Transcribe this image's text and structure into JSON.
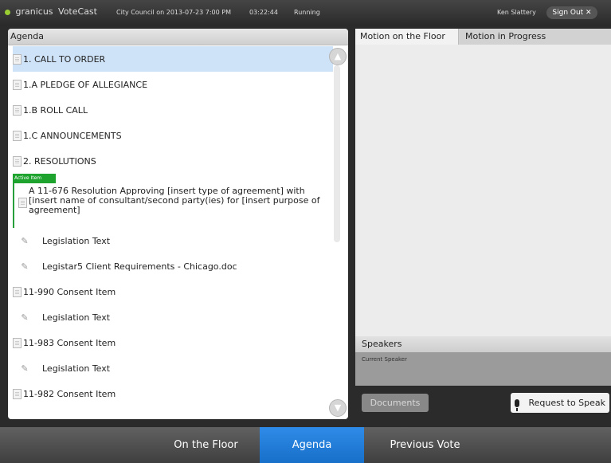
{
  "header": {
    "brand": "granicus",
    "product": "VoteCast",
    "meeting": "City Council on 2013-07-23 7:00 PM",
    "clock": "03:22:44",
    "status": "Running",
    "user": "Ken Slattery",
    "signout_label": "Sign Out ✕"
  },
  "agenda": {
    "title": "Agenda",
    "items": [
      {
        "label": "1.  CALL TO ORDER",
        "selected": true,
        "icon": "document-icon"
      },
      {
        "label": "1.A  PLEDGE OF ALLEGIANCE",
        "icon": "document-icon"
      },
      {
        "label": "1.B  ROLL CALL",
        "icon": "document-icon"
      },
      {
        "label": "1.C  ANNOUNCEMENTS",
        "icon": "document-icon"
      },
      {
        "label": "2.  RESOLUTIONS",
        "icon": "document-icon"
      }
    ],
    "active_badge": "Active Item",
    "active_text": "A 11-676 Resolution Approving [insert type of agreement] with [insert name of consultant/second party(ies) for [insert purpose of agreement]",
    "attachments": [
      {
        "label": "Legislation Text",
        "icon": "paperclip-icon"
      },
      {
        "label": "Legistar5 Client Requirements - Chicago.doc",
        "icon": "paperclip-icon"
      }
    ],
    "more_items": [
      {
        "label": "11-990 Consent Item",
        "type": "item"
      },
      {
        "label": "Legislation Text",
        "type": "attachment"
      },
      {
        "label": "11-983 Consent Item",
        "type": "item"
      },
      {
        "label": "Legislation Text",
        "type": "attachment"
      },
      {
        "label": "11-982 Consent Item",
        "type": "item"
      }
    ]
  },
  "right": {
    "tabs": [
      "Motion on the Floor",
      "Motion in Progress"
    ],
    "speakers_title": "Speakers",
    "current_speaker_label": "Current Speaker",
    "documents_label": "Documents",
    "request_label": "Request to Speak"
  },
  "nav": {
    "items": [
      "On the Floor",
      "Agenda",
      "Previous Vote"
    ],
    "active": "Agenda"
  },
  "colors": {
    "accent": "#1770c9",
    "active_green": "#1fa32f",
    "selected": "#cfe3f8"
  }
}
